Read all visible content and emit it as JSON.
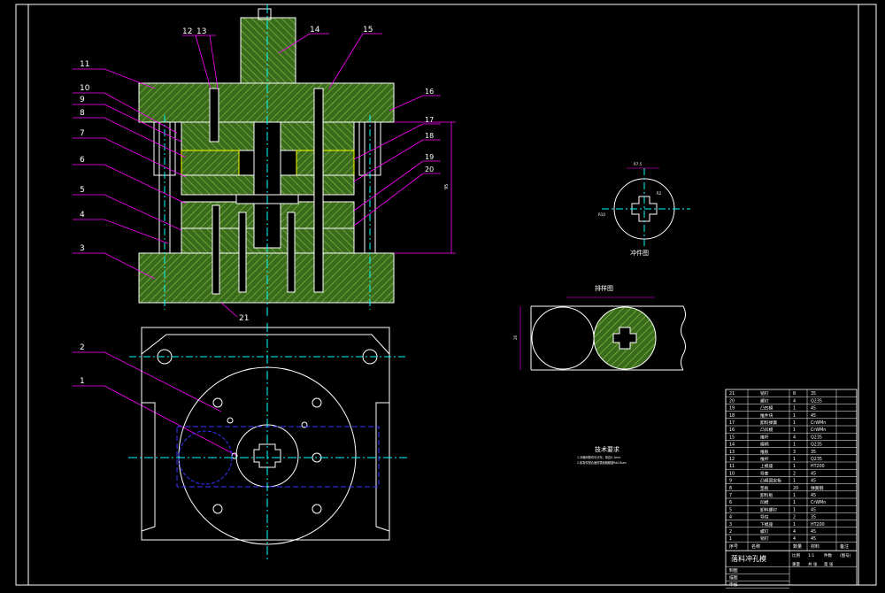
{
  "leader_numbers_left": [
    "11",
    "10",
    "9",
    "8",
    "7",
    "6",
    "5",
    "4",
    "3",
    "2",
    "1"
  ],
  "leader_numbers_top": [
    "12",
    "13",
    "14",
    "15"
  ],
  "leader_numbers_right": [
    "16",
    "17",
    "18",
    "19",
    "20"
  ],
  "leader_number_bottom": "21",
  "dimension_height": "95",
  "punch_view_title": "冲件图",
  "strip_view_title": "排样图",
  "punch_dims": [
    "R7.5",
    "R2",
    "R10"
  ],
  "strip_dim": "26",
  "tech_title": "技术要求",
  "tech_notes": [
    "1.冲裁间隙均匀分布，单边0.1mm",
    "2.各零件配合面的表面粗糙度Ra0.8μm"
  ],
  "bom_rows": [
    [
      "21",
      "销钉",
      "8",
      "35"
    ],
    [
      "20",
      "螺钉",
      "4",
      "Q235"
    ],
    [
      "19",
      "凸凹模",
      "1",
      "45"
    ],
    [
      "18",
      "推件块",
      "1",
      "45"
    ],
    [
      "17",
      "卸料弹簧",
      "1",
      "CrWMn"
    ],
    [
      "16",
      "凸凹模",
      "1",
      "CrWMn"
    ],
    [
      "15",
      "推杆",
      "4",
      "Q235"
    ],
    [
      "14",
      "模柄",
      "1",
      "Q235"
    ],
    [
      "13",
      "推板",
      "3",
      "35"
    ],
    [
      "12",
      "推杆",
      "1",
      "Q235"
    ],
    [
      "11",
      "上模座",
      "1",
      "HT200"
    ],
    [
      "10",
      "导套",
      "2",
      "45"
    ],
    [
      "9",
      "凸模固定板",
      "1",
      "45"
    ],
    [
      "8",
      "垫板",
      "20",
      "弹簧钢"
    ],
    [
      "7",
      "卸料板",
      "1",
      "45"
    ],
    [
      "6",
      "凹模",
      "1",
      "CrWMn"
    ],
    [
      "5",
      "卸料螺钉",
      "1",
      "45"
    ],
    [
      "4",
      "导柱",
      "2",
      "35"
    ],
    [
      "3",
      "下模座",
      "1",
      "HT200"
    ],
    [
      "2",
      "螺钉",
      "4",
      "45"
    ],
    [
      "1",
      "销钉",
      "4",
      "45"
    ]
  ],
  "bom_header": [
    "序号",
    "名称",
    "数量",
    "材料",
    "备注"
  ],
  "drawing_title": "落料冲孔模",
  "title_cells": [
    "比例",
    "1:1",
    "件数",
    "(图号)",
    "重量",
    "共 张",
    "第 张"
  ],
  "sign_rows": [
    "制图",
    "描图",
    "审核"
  ]
}
